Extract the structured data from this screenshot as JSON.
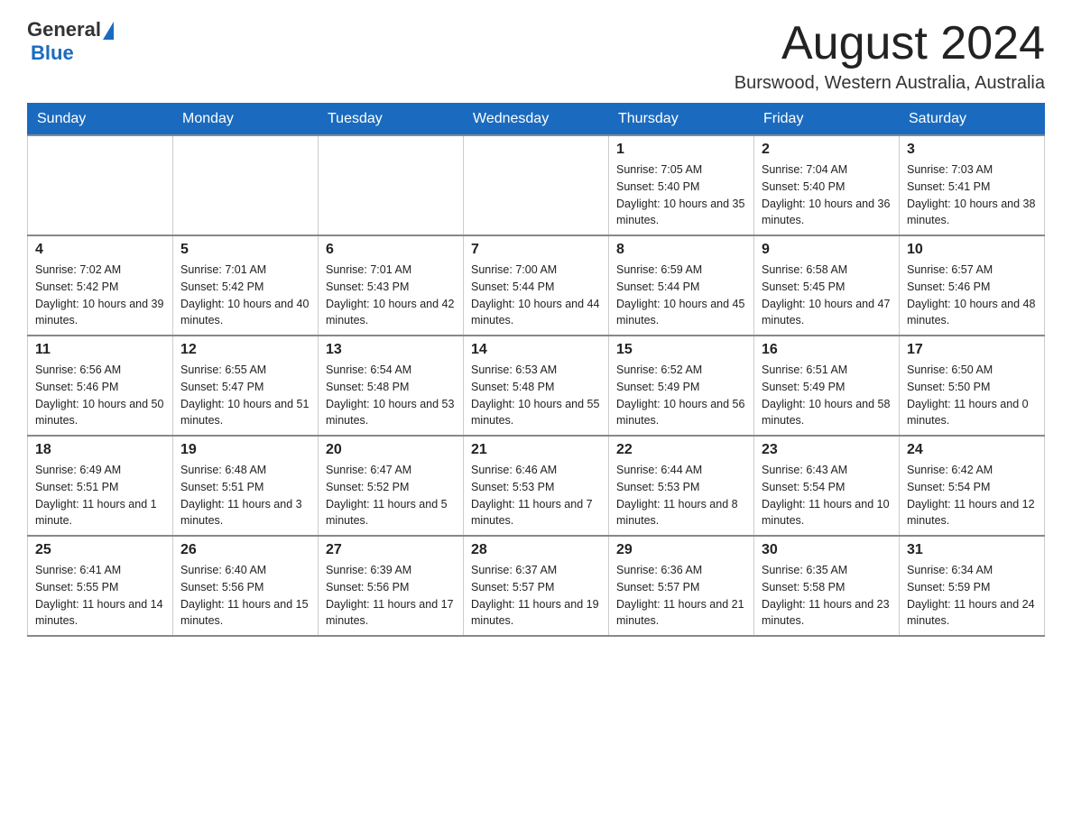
{
  "header": {
    "logo_general": "General",
    "logo_blue": "Blue",
    "month_title": "August 2024",
    "location": "Burswood, Western Australia, Australia"
  },
  "weekdays": [
    "Sunday",
    "Monday",
    "Tuesday",
    "Wednesday",
    "Thursday",
    "Friday",
    "Saturday"
  ],
  "weeks": [
    [
      {
        "day": "",
        "info": ""
      },
      {
        "day": "",
        "info": ""
      },
      {
        "day": "",
        "info": ""
      },
      {
        "day": "",
        "info": ""
      },
      {
        "day": "1",
        "info": "Sunrise: 7:05 AM\nSunset: 5:40 PM\nDaylight: 10 hours and 35 minutes."
      },
      {
        "day": "2",
        "info": "Sunrise: 7:04 AM\nSunset: 5:40 PM\nDaylight: 10 hours and 36 minutes."
      },
      {
        "day": "3",
        "info": "Sunrise: 7:03 AM\nSunset: 5:41 PM\nDaylight: 10 hours and 38 minutes."
      }
    ],
    [
      {
        "day": "4",
        "info": "Sunrise: 7:02 AM\nSunset: 5:42 PM\nDaylight: 10 hours and 39 minutes."
      },
      {
        "day": "5",
        "info": "Sunrise: 7:01 AM\nSunset: 5:42 PM\nDaylight: 10 hours and 40 minutes."
      },
      {
        "day": "6",
        "info": "Sunrise: 7:01 AM\nSunset: 5:43 PM\nDaylight: 10 hours and 42 minutes."
      },
      {
        "day": "7",
        "info": "Sunrise: 7:00 AM\nSunset: 5:44 PM\nDaylight: 10 hours and 44 minutes."
      },
      {
        "day": "8",
        "info": "Sunrise: 6:59 AM\nSunset: 5:44 PM\nDaylight: 10 hours and 45 minutes."
      },
      {
        "day": "9",
        "info": "Sunrise: 6:58 AM\nSunset: 5:45 PM\nDaylight: 10 hours and 47 minutes."
      },
      {
        "day": "10",
        "info": "Sunrise: 6:57 AM\nSunset: 5:46 PM\nDaylight: 10 hours and 48 minutes."
      }
    ],
    [
      {
        "day": "11",
        "info": "Sunrise: 6:56 AM\nSunset: 5:46 PM\nDaylight: 10 hours and 50 minutes."
      },
      {
        "day": "12",
        "info": "Sunrise: 6:55 AM\nSunset: 5:47 PM\nDaylight: 10 hours and 51 minutes."
      },
      {
        "day": "13",
        "info": "Sunrise: 6:54 AM\nSunset: 5:48 PM\nDaylight: 10 hours and 53 minutes."
      },
      {
        "day": "14",
        "info": "Sunrise: 6:53 AM\nSunset: 5:48 PM\nDaylight: 10 hours and 55 minutes."
      },
      {
        "day": "15",
        "info": "Sunrise: 6:52 AM\nSunset: 5:49 PM\nDaylight: 10 hours and 56 minutes."
      },
      {
        "day": "16",
        "info": "Sunrise: 6:51 AM\nSunset: 5:49 PM\nDaylight: 10 hours and 58 minutes."
      },
      {
        "day": "17",
        "info": "Sunrise: 6:50 AM\nSunset: 5:50 PM\nDaylight: 11 hours and 0 minutes."
      }
    ],
    [
      {
        "day": "18",
        "info": "Sunrise: 6:49 AM\nSunset: 5:51 PM\nDaylight: 11 hours and 1 minute."
      },
      {
        "day": "19",
        "info": "Sunrise: 6:48 AM\nSunset: 5:51 PM\nDaylight: 11 hours and 3 minutes."
      },
      {
        "day": "20",
        "info": "Sunrise: 6:47 AM\nSunset: 5:52 PM\nDaylight: 11 hours and 5 minutes."
      },
      {
        "day": "21",
        "info": "Sunrise: 6:46 AM\nSunset: 5:53 PM\nDaylight: 11 hours and 7 minutes."
      },
      {
        "day": "22",
        "info": "Sunrise: 6:44 AM\nSunset: 5:53 PM\nDaylight: 11 hours and 8 minutes."
      },
      {
        "day": "23",
        "info": "Sunrise: 6:43 AM\nSunset: 5:54 PM\nDaylight: 11 hours and 10 minutes."
      },
      {
        "day": "24",
        "info": "Sunrise: 6:42 AM\nSunset: 5:54 PM\nDaylight: 11 hours and 12 minutes."
      }
    ],
    [
      {
        "day": "25",
        "info": "Sunrise: 6:41 AM\nSunset: 5:55 PM\nDaylight: 11 hours and 14 minutes."
      },
      {
        "day": "26",
        "info": "Sunrise: 6:40 AM\nSunset: 5:56 PM\nDaylight: 11 hours and 15 minutes."
      },
      {
        "day": "27",
        "info": "Sunrise: 6:39 AM\nSunset: 5:56 PM\nDaylight: 11 hours and 17 minutes."
      },
      {
        "day": "28",
        "info": "Sunrise: 6:37 AM\nSunset: 5:57 PM\nDaylight: 11 hours and 19 minutes."
      },
      {
        "day": "29",
        "info": "Sunrise: 6:36 AM\nSunset: 5:57 PM\nDaylight: 11 hours and 21 minutes."
      },
      {
        "day": "30",
        "info": "Sunrise: 6:35 AM\nSunset: 5:58 PM\nDaylight: 11 hours and 23 minutes."
      },
      {
        "day": "31",
        "info": "Sunrise: 6:34 AM\nSunset: 5:59 PM\nDaylight: 11 hours and 24 minutes."
      }
    ]
  ]
}
